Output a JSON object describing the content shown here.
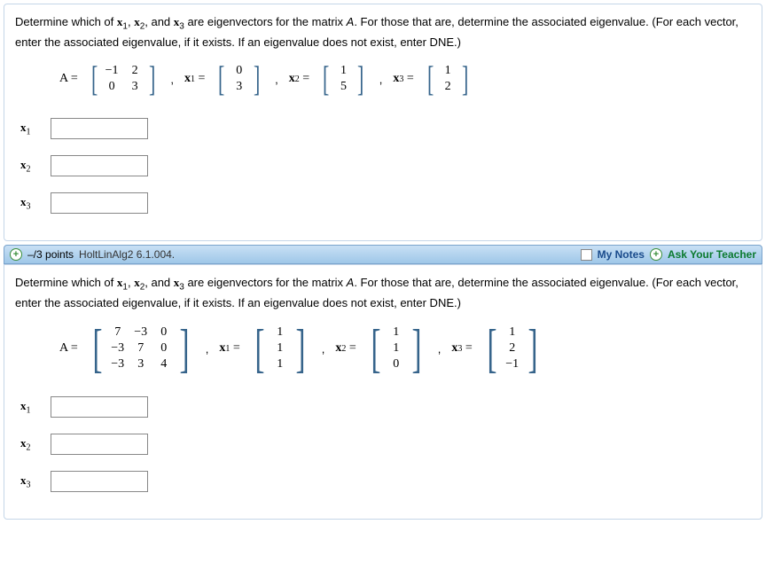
{
  "q1": {
    "prompt": "Determine which of 𝐱₁, 𝐱₂, and 𝐱₃ are eigenvectors for the matrix A. For those that are, determine the associated eigenvalue. (For each vector, enter the associated eigenvalue, if it exists. If an eigenvalue does not exist, enter DNE.)",
    "A_label": "A =",
    "A_rows": [
      [
        "−1",
        "2"
      ],
      [
        "0",
        "3"
      ]
    ],
    "x1_label": "𝐱₁ =",
    "x1": [
      "0",
      "3"
    ],
    "x2_label": "𝐱₂ =",
    "x2": [
      "1",
      "5"
    ],
    "x3_label": "𝐱₃ =",
    "x3": [
      "1",
      "2"
    ],
    "ans_labels": {
      "x1": "𝐱₁",
      "x2": "𝐱₂",
      "x3": "𝐱₃"
    },
    "ans_values": {
      "x1": "",
      "x2": "",
      "x3": ""
    }
  },
  "header2": {
    "points": "–/3 points",
    "source": "HoltLinAlg2 6.1.004.",
    "notes": "My Notes",
    "ask": "Ask Your Teacher"
  },
  "q2": {
    "prompt": "Determine which of 𝐱₁, 𝐱₂, and 𝐱₃ are eigenvectors for the matrix A. For those that are, determine the associated eigenvalue. (For each vector, enter the associated eigenvalue, if it exists. If an eigenvalue does not exist, enter DNE.)",
    "A_label": "A =",
    "A_rows": [
      [
        "7",
        "−3",
        "0"
      ],
      [
        "−3",
        "7",
        "0"
      ],
      [
        "−3",
        "3",
        "4"
      ]
    ],
    "x1_label": "𝐱₁ =",
    "x1": [
      "1",
      "1",
      "1"
    ],
    "x2_label": "𝐱₂ =",
    "x2": [
      "1",
      "1",
      "0"
    ],
    "x3_label": "𝐱₃ =",
    "x3": [
      "1",
      "2",
      "−1"
    ],
    "ans_labels": {
      "x1": "𝐱₁",
      "x2": "𝐱₂",
      "x3": "𝐱₃"
    },
    "ans_values": {
      "x1": "",
      "x2": "",
      "x3": ""
    }
  }
}
